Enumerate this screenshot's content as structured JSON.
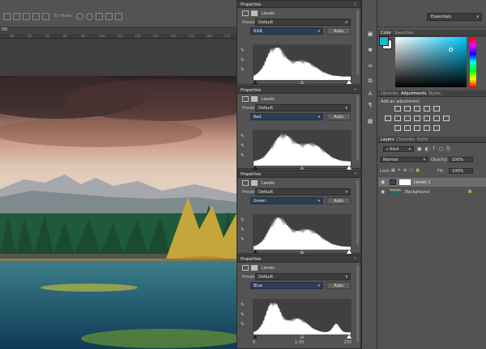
{
  "workspace": {
    "label": "Essentials"
  },
  "optbar": {
    "mode_label": "3D Mode:"
  },
  "doc_tab": {
    "label": "PEI"
  },
  "ruler": {
    "ticks": [
      "40",
      "50",
      "60",
      "80",
      "90",
      "100",
      "110",
      "120",
      "130",
      "140",
      "150",
      "160",
      "170"
    ]
  },
  "properties": [
    {
      "title": "Properties",
      "adjustment": "Levels",
      "preset_label": "Preset:",
      "preset_value": "Default",
      "channel": "RGB",
      "auto_label": "Auto",
      "histogram_color": "#ffffff"
    },
    {
      "title": "Properties",
      "adjustment": "Levels",
      "preset_label": "Preset:",
      "preset_value": "Default",
      "channel": "Red",
      "auto_label": "Auto",
      "histogram_color": "#ffffff"
    },
    {
      "title": "Properties",
      "adjustment": "Levels",
      "preset_label": "Preset:",
      "preset_value": "Default",
      "channel": "Green",
      "auto_label": "Auto",
      "histogram_color": "#ffffff"
    },
    {
      "title": "Properties",
      "adjustment": "Levels",
      "preset_label": "Preset:",
      "preset_value": "Default",
      "channel": "Blue",
      "auto_label": "Auto",
      "histogram_color": "#ffffff",
      "input_values": [
        "0",
        "1.00",
        "255"
      ]
    }
  ],
  "color_panel": {
    "tabs": [
      "Color",
      "Swatches"
    ],
    "foreground": "#1ab4d8",
    "background": "#ffffff"
  },
  "adjustments_panel": {
    "tabs": [
      "Libraries",
      "Adjustments",
      "Styles"
    ],
    "hint": "Add an adjustment"
  },
  "layers_panel": {
    "tabs": [
      "Layers",
      "Channels",
      "Paths"
    ],
    "kind_label": "Kind",
    "blend_mode": "Normal",
    "opacity_label": "Opacity:",
    "opacity_value": "100%",
    "lock_label": "Lock:",
    "fill_label": "Fill:",
    "fill_value": "100%",
    "layers": [
      {
        "name": "Levels 1",
        "selected": true
      },
      {
        "name": "Background",
        "selected": false
      }
    ]
  },
  "colors": {
    "accent": "#2c3d55",
    "panel": "#535353",
    "dark": "#3c3c3c"
  }
}
